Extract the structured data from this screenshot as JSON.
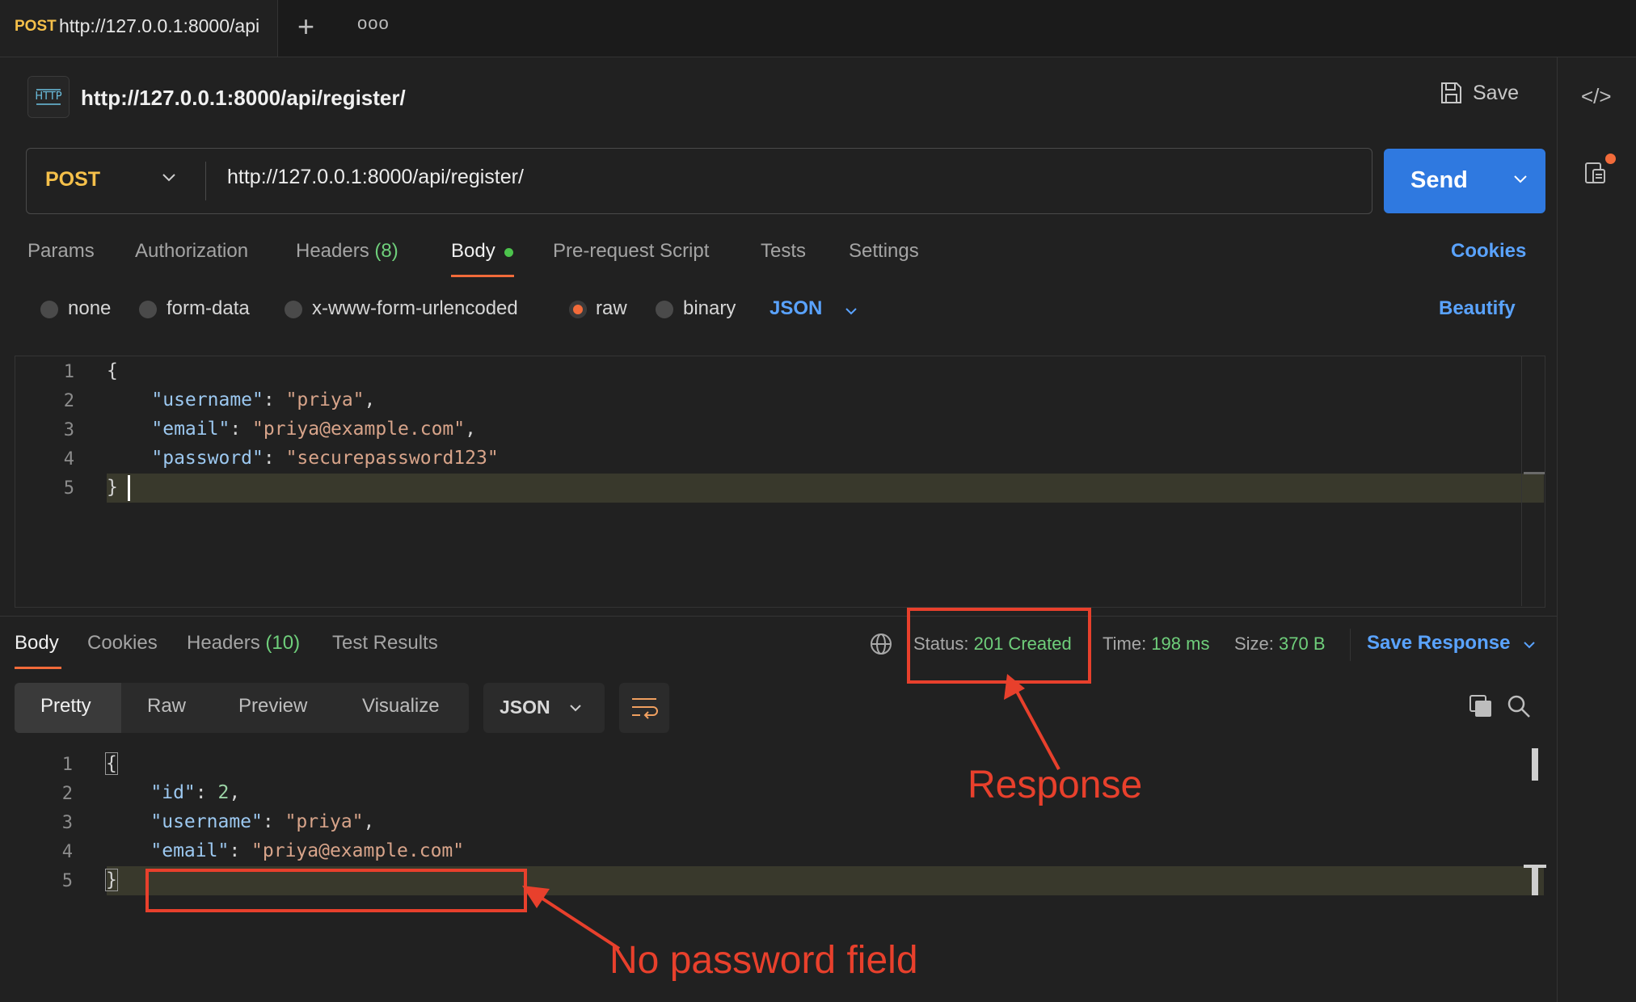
{
  "tab": {
    "method": "POST",
    "title": "http://127.0.0.1:8000/api",
    "new_tab_symbol": "+",
    "more_symbol": "ooo"
  },
  "request": {
    "title": "http://127.0.0.1:8000/api/register/",
    "save_label": "Save",
    "method": "POST",
    "url": "http://127.0.0.1:8000/api/register/",
    "send_label": "Send",
    "tabs": {
      "params": "Params",
      "authorization": "Authorization",
      "headers": "Headers",
      "headers_count": "(8)",
      "body": "Body",
      "prerequest": "Pre-request Script",
      "tests": "Tests",
      "settings": "Settings"
    },
    "cookies_label": "Cookies",
    "body_types": {
      "none": "none",
      "form_data": "form-data",
      "urlencoded": "x-www-form-urlencoded",
      "raw": "raw",
      "binary": "binary"
    },
    "body_format": "JSON",
    "beautify_label": "Beautify",
    "line_numbers": [
      "1",
      "2",
      "3",
      "4",
      "5"
    ],
    "body_lines": {
      "l1": "{",
      "l2_key": "\"username\"",
      "l2_val": "\"priya\"",
      "l3_key": "\"email\"",
      "l3_val": "\"priya@example.com\"",
      "l4_key": "\"password\"",
      "l4_val": "\"securepassword123\"",
      "l5": "}"
    }
  },
  "response": {
    "tabs": {
      "body": "Body",
      "cookies": "Cookies",
      "headers": "Headers",
      "headers_count": "(10)",
      "test_results": "Test Results"
    },
    "status_label": "Status:",
    "status_value": "201 Created",
    "time_label": "Time:",
    "time_value": "198 ms",
    "size_label": "Size:",
    "size_value": "370 B",
    "save_response_label": "Save Response",
    "view_modes": {
      "pretty": "Pretty",
      "raw": "Raw",
      "preview": "Preview",
      "visualize": "Visualize"
    },
    "format": "JSON",
    "line_numbers": [
      "1",
      "2",
      "3",
      "4",
      "5"
    ],
    "body_lines": {
      "l1": "{",
      "l2_key": "\"id\"",
      "l2_val": "2",
      "l3_key": "\"username\"",
      "l3_val": "\"priya\"",
      "l4_key": "\"email\"",
      "l4_val": "\"priya@example.com\"",
      "l5": "}"
    }
  },
  "annotations": {
    "response_label": "Response",
    "no_password_label": "No password field",
    "color": "#e8402c"
  },
  "colors": {
    "method": "#f5c04a",
    "send": "#2f79e0",
    "link": "#5aa3ff",
    "accent": "#f26b3a",
    "success": "#6fcf7b"
  }
}
